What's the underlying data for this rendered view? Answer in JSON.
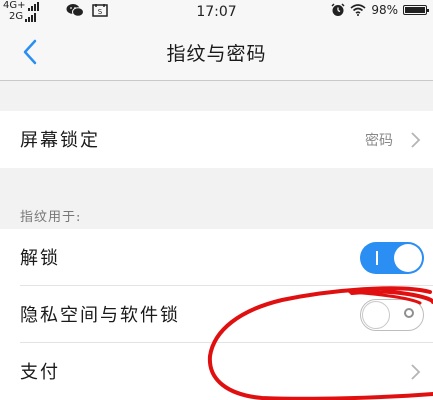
{
  "status_bar": {
    "network_top": "4G+",
    "network_bottom": "2G",
    "time": "17:07",
    "battery": "98%",
    "battery_level": 0.98,
    "app_icons": [
      "wechat-icon",
      "message-icon"
    ],
    "right_icons": [
      "alarm-icon",
      "wifi-icon",
      "battery-icon"
    ]
  },
  "nav": {
    "title": "指纹与密码",
    "back_icon": "chevron-left-icon"
  },
  "screen_lock": {
    "label": "屏幕锁定",
    "value": "密码"
  },
  "fingerprint_section": {
    "header": "指纹用于:",
    "items": [
      {
        "label": "解锁",
        "toggle": true
      },
      {
        "label": "隐私空间与软件锁",
        "toggle": false
      },
      {
        "label": "支付",
        "chevron": true
      }
    ]
  },
  "colors": {
    "accent": "#2a8ef2",
    "annotation": "#e01010"
  }
}
